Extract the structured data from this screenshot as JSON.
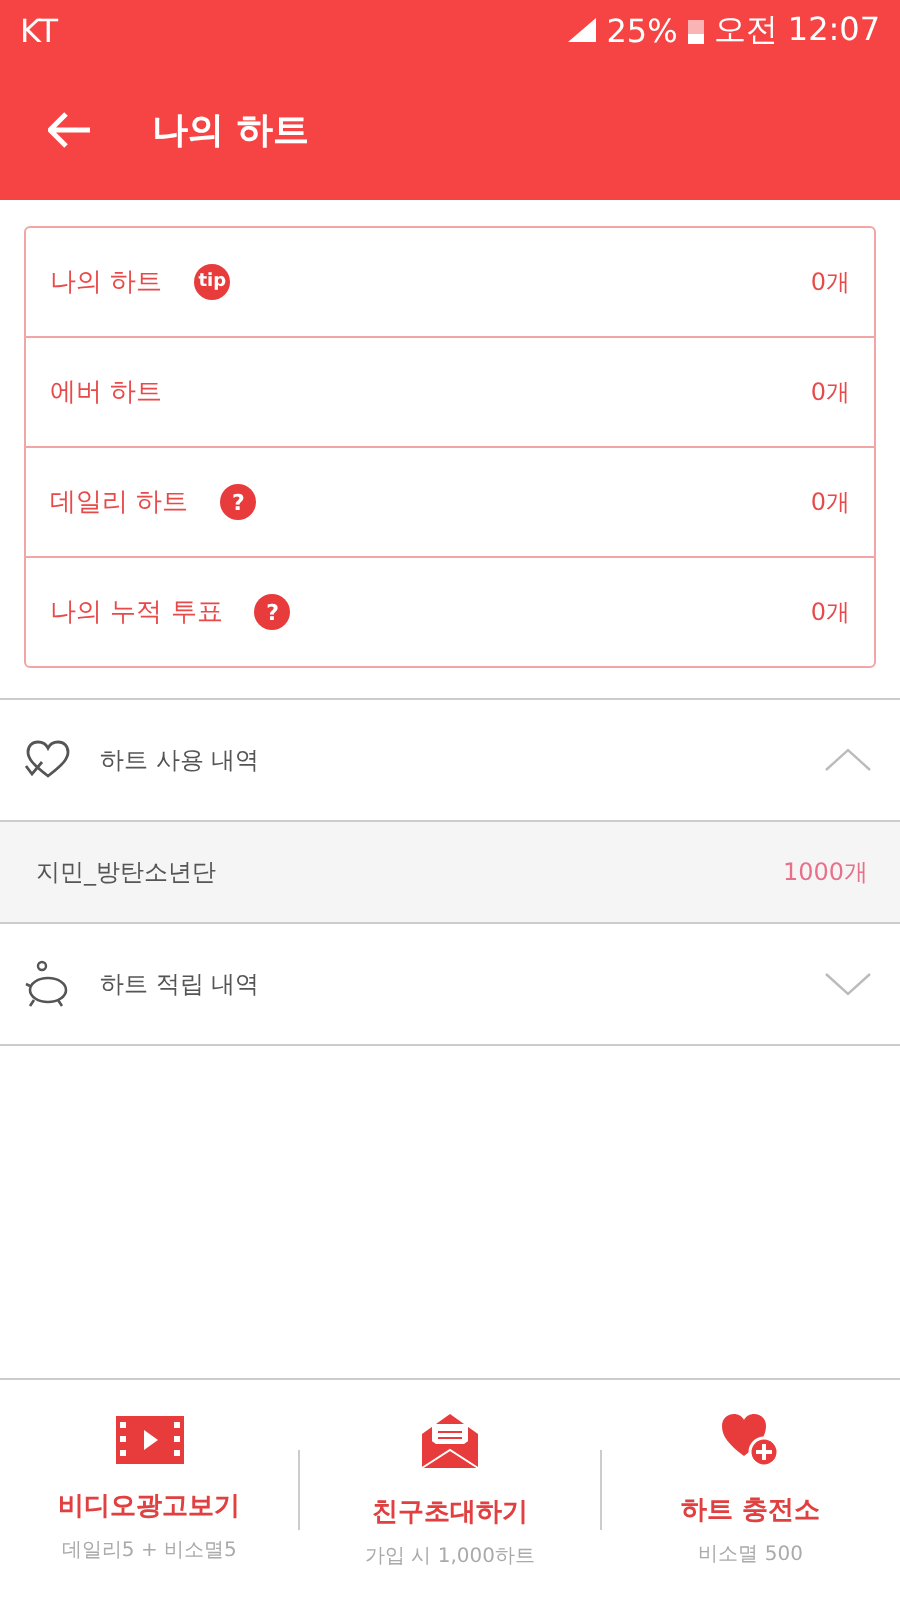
{
  "status_bar": {
    "carrier": "KT",
    "battery": "25%",
    "time": "오전 12:07"
  },
  "app_bar": {
    "title": "나의 하트"
  },
  "heart_counts": [
    {
      "label": "나의 하트",
      "badge": "tip",
      "value": "0개"
    },
    {
      "label": "에버 하트",
      "value": "0개"
    },
    {
      "label": "데일리 하트",
      "badge": "?",
      "value": "0개"
    },
    {
      "label": "나의 누적 투표",
      "badge": "?",
      "value": "0개"
    }
  ],
  "sections": [
    {
      "kind": "usage",
      "title": "하트 사용 내역",
      "expanded": true,
      "items": [
        {
          "name": "지민_방탄소년단",
          "amount": "1000개"
        }
      ]
    },
    {
      "kind": "earning",
      "title": "하트 적립 내역",
      "expanded": false
    }
  ],
  "bottom_actions": [
    {
      "kind": "video",
      "label": "비디오광고보기",
      "sub": "데일리5 + 비소멸5"
    },
    {
      "kind": "invite",
      "label": "친구초대하기",
      "sub": "가입 시 1,000하트"
    },
    {
      "kind": "charge",
      "label": "하트 충전소",
      "sub": "비소멸 500"
    }
  ]
}
